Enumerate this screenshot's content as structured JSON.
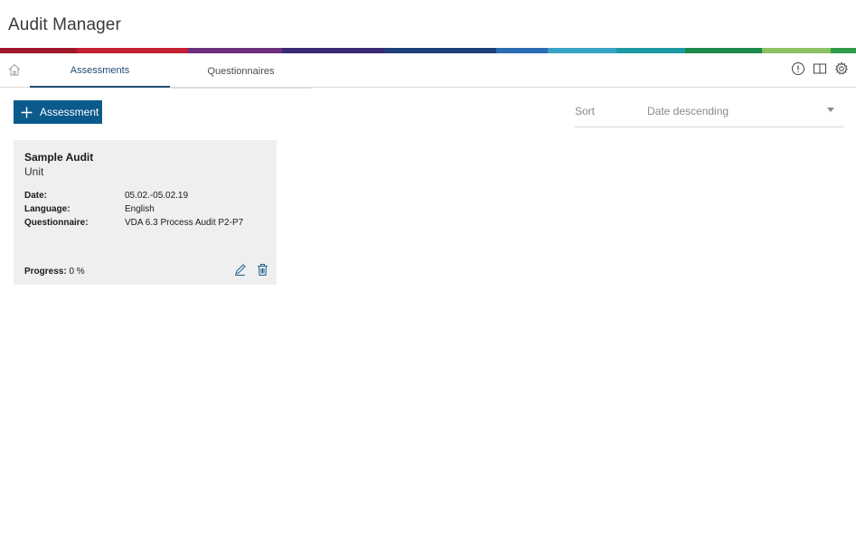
{
  "app": {
    "title": "Audit Manager"
  },
  "brand_strip": [
    "#a0182b",
    "#c22032",
    "#6c2f7f",
    "#3b2a74",
    "#1d3f7a",
    "#2b6db3",
    "#39a3c5",
    "#1d9aa3",
    "#1e8a4a",
    "#8cc062",
    "#2e9c48"
  ],
  "tabs": [
    {
      "label": "Assessments",
      "active": true
    },
    {
      "label": "Questionnaires",
      "active": false
    }
  ],
  "header_icons": [
    "info-icon",
    "book-icon",
    "gear-icon"
  ],
  "toolbar": {
    "add_label": "Assessment"
  },
  "sort": {
    "label": "Sort",
    "value": "Date descending"
  },
  "cards": [
    {
      "title": "Sample Audit",
      "subtitle": "Unit",
      "date_label": "Date:",
      "date_value": "05.02.-05.02.19",
      "language_label": "Language:",
      "language_value": "English",
      "questionnaire_label": "Questionnaire:",
      "questionnaire_value": "VDA 6.3 Process Audit P2-P7",
      "progress_label": "Progress:",
      "progress_value": "0 %"
    }
  ]
}
